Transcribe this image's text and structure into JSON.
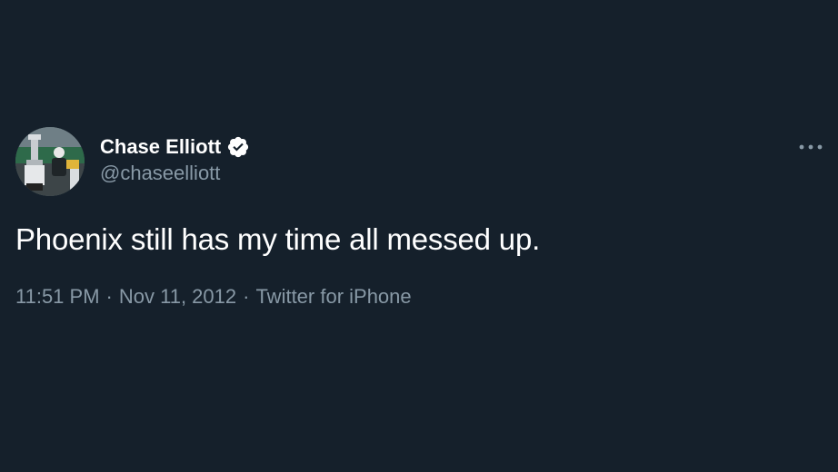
{
  "author": {
    "display_name": "Chase Elliott",
    "handle": "@chaseelliott",
    "verified": true,
    "avatar_icon": "profile-photo-trophy"
  },
  "tweet": {
    "text": "Phoenix still has my time all messed up.",
    "time": "11:51 PM",
    "date": "Nov 11, 2012",
    "source": "Twitter for iPhone",
    "separator": "·"
  },
  "icons": {
    "verified": "verified-badge-icon",
    "more": "more-options-icon"
  },
  "colors": {
    "background": "#15202b",
    "primary_text": "#ffffff",
    "secondary_text": "#8899a6",
    "verified_badge": "#ffffff"
  }
}
